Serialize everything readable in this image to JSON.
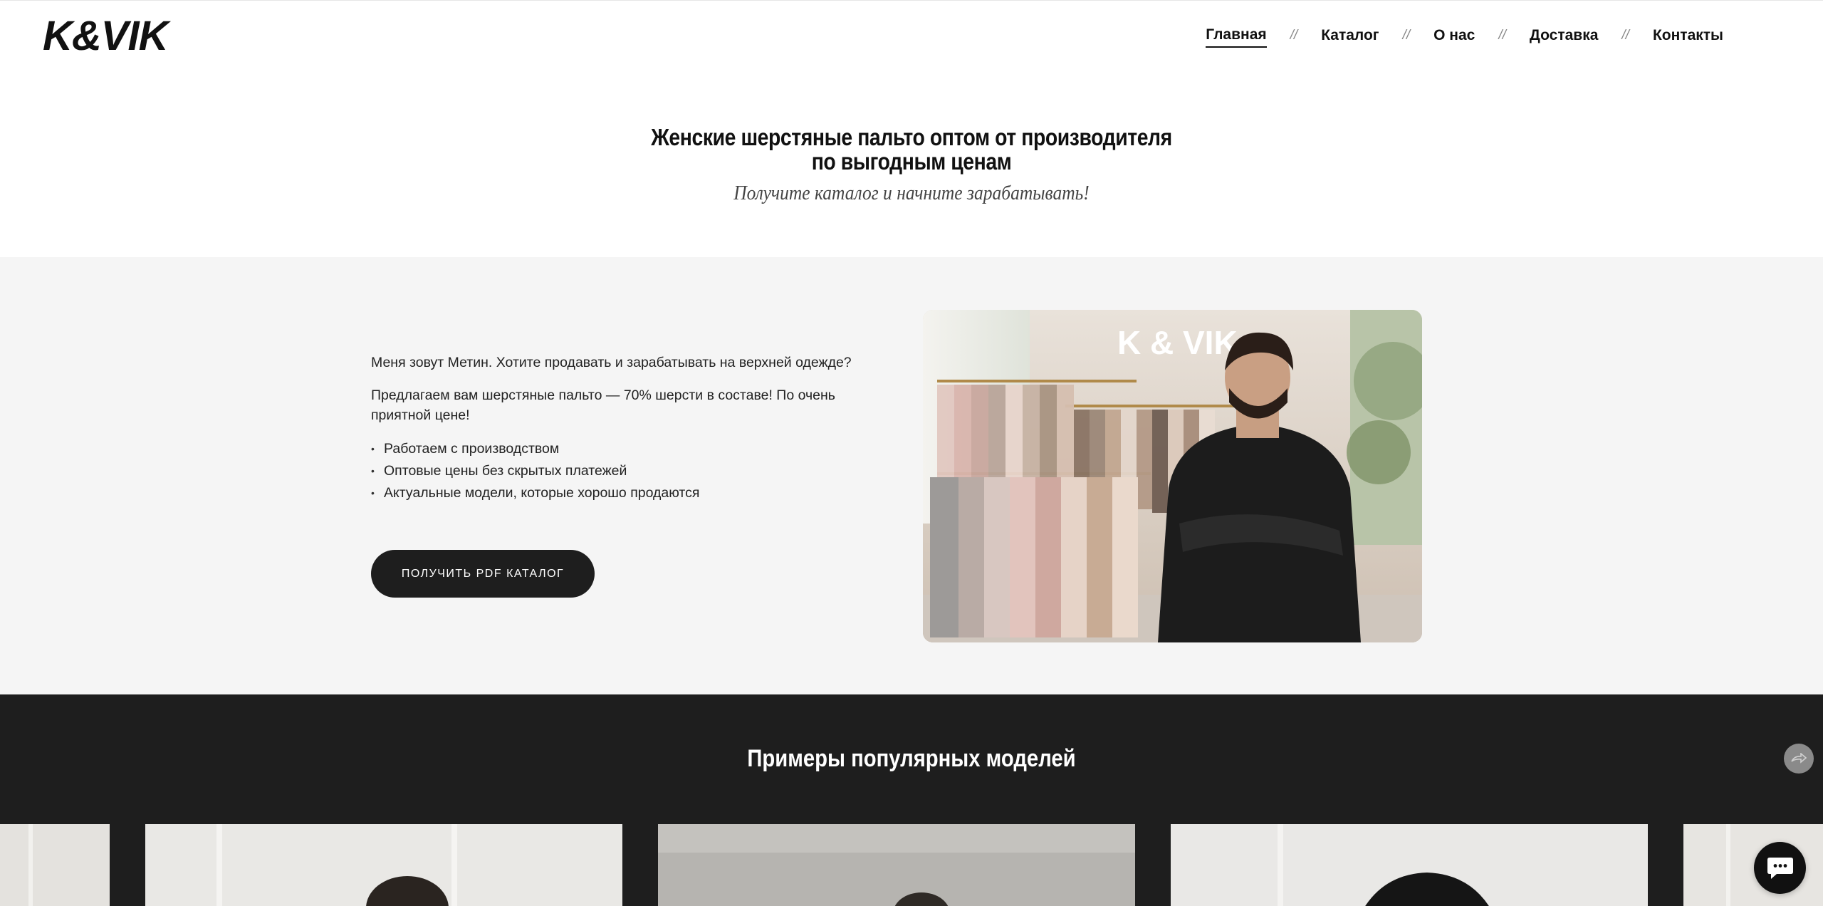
{
  "header": {
    "logo": "K&VIK",
    "nav": [
      {
        "label": "Главная",
        "active": true
      },
      {
        "label": "Каталог",
        "active": false
      },
      {
        "label": "О нас",
        "active": false
      },
      {
        "label": "Доставка",
        "active": false
      },
      {
        "label": "Контакты",
        "active": false
      }
    ],
    "separator": "//"
  },
  "hero": {
    "title_line1": "Женские шерстяные пальто оптом от производителя",
    "title_line2": "по выгодным ценам",
    "subtitle": "Получите каталог и начните зарабатывать!"
  },
  "about": {
    "paragraph1": "Меня зовут Метин. Хотите продавать и зарабатывать на верхней одежде?",
    "paragraph2": "Предлагаем вам шерстяные пальто — 70% шерсти в составе! По очень приятной цене!",
    "bullets": [
      "Работаем с производством",
      "Оптовые цены без скрытых платежей",
      "Актуальные модели, которые хорошо продаются"
    ],
    "cta_label": "ПОЛУЧИТЬ PDF КАТАЛОГ",
    "photo_sign": "K & VIK"
  },
  "models": {
    "title": "Примеры популярных моделей"
  },
  "colors": {
    "dark": "#1e1e1e",
    "light_bg": "#f5f5f5",
    "text": "#1b1b1b"
  },
  "icons": {
    "next": "arrow-right-icon",
    "chat": "chat-bubble-icon"
  }
}
